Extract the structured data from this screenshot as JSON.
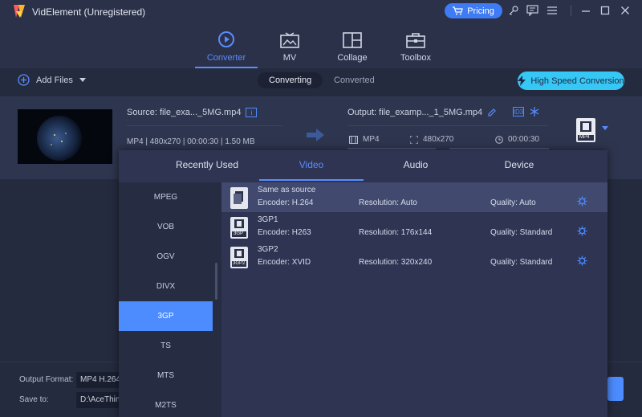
{
  "app": {
    "title": "VidElement (Unregistered)",
    "pricing_label": "Pricing"
  },
  "icons": {
    "logo": "app-logo-icon",
    "cart": "cart-icon",
    "key": "key-icon",
    "chat": "chat-icon",
    "menu": "menu-icon",
    "minimize": "minimize-icon",
    "maximize": "maximize-icon",
    "close": "close-icon"
  },
  "nav": {
    "tabs": [
      {
        "label": "Converter",
        "icon": "converter-icon",
        "active": true
      },
      {
        "label": "MV",
        "icon": "mv-icon",
        "active": false
      },
      {
        "label": "Collage",
        "icon": "collage-icon",
        "active": false
      },
      {
        "label": "Toolbox",
        "icon": "toolbox-icon",
        "active": false
      }
    ]
  },
  "toolbar": {
    "add_files_label": "Add Files",
    "converting_label": "Converting",
    "converted_label": "Converted",
    "high_speed_label": "High Speed Conversion"
  },
  "file": {
    "source_name": "Source: file_exa..._5MG.mp4",
    "source_meta": "MP4 | 480x270 | 00:00:30 | 1.50 MB",
    "output_name": "Output: file_examp..._1_5MG.mp4",
    "output_format": "MP4",
    "output_resolution": "480x270",
    "output_duration": "00:00:30",
    "format_badge": "MP4"
  },
  "popup": {
    "tabs": [
      {
        "label": "Recently Used",
        "active": false
      },
      {
        "label": "Video",
        "active": true
      },
      {
        "label": "Audio",
        "active": false
      },
      {
        "label": "Device",
        "active": false
      }
    ],
    "categories": [
      {
        "label": "MPEG",
        "active": false
      },
      {
        "label": "VOB",
        "active": false
      },
      {
        "label": "OGV",
        "active": false
      },
      {
        "label": "DIVX",
        "active": false
      },
      {
        "label": "3GP",
        "active": true
      },
      {
        "label": "TS",
        "active": false
      },
      {
        "label": "MTS",
        "active": false
      },
      {
        "label": "M2TS",
        "active": false
      }
    ],
    "options": [
      {
        "name": "Same as source",
        "encoder": "Encoder: H.264",
        "resolution": "Resolution: Auto",
        "quality": "Quality: Auto",
        "badge": "",
        "selected": true
      },
      {
        "name": "3GP1",
        "encoder": "Encoder: H263",
        "resolution": "Resolution: 176x144",
        "quality": "Quality: Standard",
        "badge": "3GP",
        "selected": false
      },
      {
        "name": "3GP2",
        "encoder": "Encoder: XVID",
        "resolution": "Resolution: 320x240",
        "quality": "Quality: Standard",
        "badge": "3GP2",
        "selected": false
      }
    ]
  },
  "bottom": {
    "output_format_label": "Output Format:",
    "output_format_value": "MP4 H.264",
    "save_to_label": "Save to:",
    "save_to_value": "D:\\AceThin"
  },
  "colors": {
    "accent": "#4d8cff",
    "high_speed": "#36c7f5",
    "background": "#252b3f",
    "popup": "#2e3452"
  }
}
